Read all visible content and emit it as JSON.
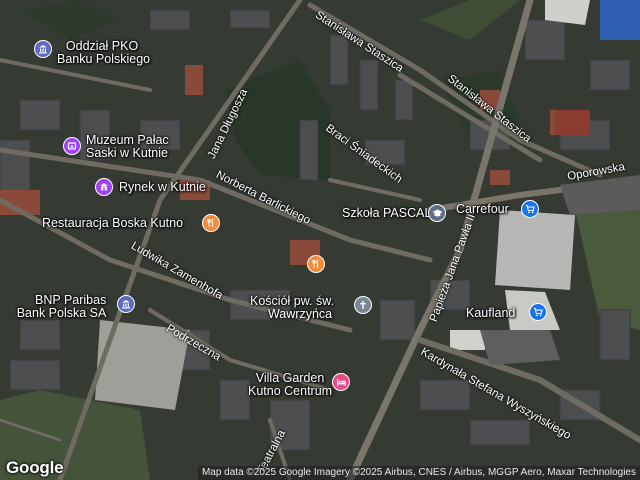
{
  "map": {
    "provider_logo": "Google",
    "attribution": "Map data ©2025 Google Imagery ©2025 Airbus, CNES / Airbus, MGGP Aero, Maxar Technologies"
  },
  "colors": {
    "bank": "#5c6bc0",
    "museum": "#a142f4",
    "restaurant": "#f28b3c",
    "shopping": "#1a73e8",
    "church": "#7b8794",
    "hotel": "#e94b8a",
    "school": "#5f6f86"
  },
  "pois": [
    {
      "name": "Oddział PKO Banku Polskiego",
      "line1": "Oddział PKO",
      "line2": "Banku Polskiego",
      "category": "bank",
      "icon": "bank-icon"
    },
    {
      "name": "Muzeum Pałac Saski w Kutnie",
      "line1": "Muzeum Pałac",
      "line2": "Saski w Kutnie",
      "category": "museum",
      "icon": "museum-icon"
    },
    {
      "name": "Rynek w Kutnie",
      "line1": "Rynek w Kutnie",
      "line2": "",
      "category": "museum",
      "icon": "museum-icon"
    },
    {
      "name": "Restauracja Boska Kutno",
      "line1": "Restauracja Boska Kutno",
      "line2": "",
      "category": "restaurant",
      "icon": "fork-knife-icon"
    },
    {
      "name": "Restaurant",
      "line1": "",
      "line2": "",
      "category": "restaurant",
      "icon": "fork-knife-icon"
    },
    {
      "name": "Szkoła PASCAL",
      "line1": "Szkoła PASCAL",
      "line2": "",
      "category": "school",
      "icon": "school-cap-icon"
    },
    {
      "name": "Carrefour",
      "line1": "Carrefour",
      "line2": "",
      "category": "shopping",
      "icon": "shopping-cart-icon"
    },
    {
      "name": "BNP Paribas Bank Polska SA",
      "line1": "BNP Paribas",
      "line2": "Bank Polska SA",
      "category": "bank",
      "icon": "bank-icon"
    },
    {
      "name": "Kościół pw. św. Wawrzyńca",
      "line1": "Kościół pw. św.",
      "line2": "Wawrzyńca",
      "category": "church",
      "icon": "cross-icon"
    },
    {
      "name": "Kaufland",
      "line1": "Kaufland",
      "line2": "",
      "category": "shopping",
      "icon": "shopping-cart-icon"
    },
    {
      "name": "Villa Garden Kutno Centrum",
      "line1": "Villa Garden",
      "line2": "Kutno Centrum",
      "category": "hotel",
      "icon": "bed-icon"
    }
  ],
  "streets": [
    "Stanisława Staszica",
    "Stanisława Staszica",
    "Oporowska",
    "Jana Długosza",
    "Braci Śniadeckich",
    "Norberta Barlickiego",
    "Ludwika Zamenhofa",
    "Papieża Jana Pawła II",
    "Podrzeczna",
    "Kardynała Stefana Wyszyńskiego",
    "Teatralna"
  ]
}
